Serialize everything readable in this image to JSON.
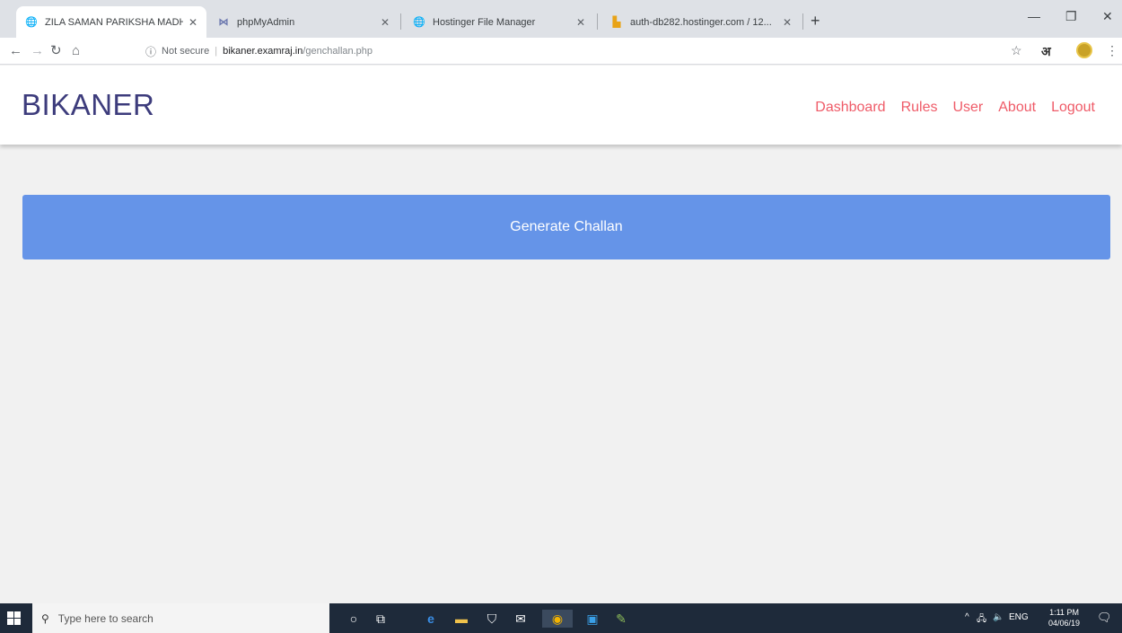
{
  "browser": {
    "tabs": [
      {
        "label": "ZILA SAMAN PARIKSHA MADHY...",
        "icon": "globe-icon",
        "active": true
      },
      {
        "label": "phpMyAdmin",
        "icon": "phpmyadmin-icon",
        "active": false
      },
      {
        "label": "Hostinger File Manager",
        "icon": "globe-icon",
        "active": false
      },
      {
        "label": "auth-db282.hostinger.com / 12...",
        "icon": "database-icon",
        "active": false
      }
    ],
    "address": {
      "security": "Not secure",
      "host": "bikaner.examraj.in",
      "path": "/genchallan.php"
    },
    "extension_label": "अ"
  },
  "site": {
    "brand": "BIKANER",
    "nav": [
      "Dashboard",
      "Rules",
      "User",
      "About",
      "Logout"
    ]
  },
  "main": {
    "generate_label": "Generate Challan"
  },
  "taskbar": {
    "search_placeholder": "Type here to search",
    "tray_lang": "ENG",
    "time": "1:11 PM",
    "date": "04/06/19"
  },
  "colors": {
    "brand": "#3d3c7c",
    "nav_link": "#ef5b68",
    "button": "#6594e8",
    "background": "#f1f1f1",
    "taskbar": "#1e2a3a"
  }
}
